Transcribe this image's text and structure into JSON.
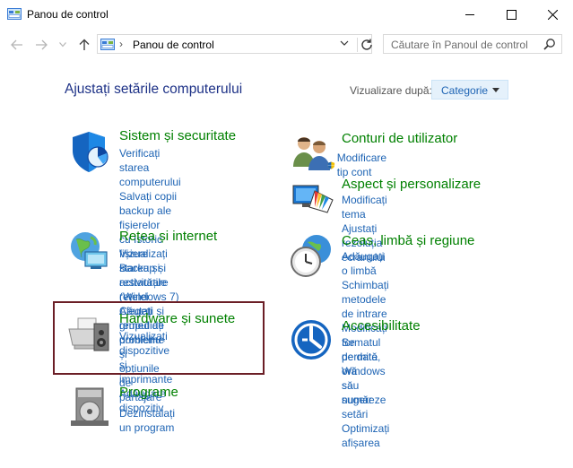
{
  "window": {
    "title": "Panou de control"
  },
  "address": {
    "location": "Panou de control"
  },
  "search": {
    "placeholder": "Căutare în Panoul de control"
  },
  "header": {
    "title": "Ajustați setările computerului",
    "view_by_label": "Vizualizare după:",
    "view_by_value": "Categorie"
  },
  "categories": [
    {
      "title": "Sistem și securitate",
      "links": [
        "Verificați starea computerului",
        "Salvați copii backup ale fișierelor",
        "cu Istoric fișiere",
        "Backup și restaurare (Windows 7)",
        "Căutați și remediați probleme"
      ]
    },
    {
      "title": "Rețea și internet",
      "links": [
        "Vizualizați starea și activitățile",
        "rețelei",
        "Alegeți grupul de domiciliu și",
        "opțiunile de partajare"
      ]
    },
    {
      "title": "Hardware și sunete",
      "links": [
        "Vizualizați dispozitive și",
        "imprimante",
        "Adăugare dispozitiv"
      ]
    },
    {
      "title": "Programe",
      "links": [
        "Dezinstalați un program"
      ]
    },
    {
      "title": "Conturi de utilizator",
      "links": [
        "Modificare tip cont"
      ]
    },
    {
      "title": "Aspect și personalizare",
      "links": [
        "Modificați tema",
        "Ajustați rezoluția ecranului"
      ]
    },
    {
      "title": "Ceas, limbă și regiune",
      "links": [
        "Adăugați o limbă",
        "Schimbați metodele de intrare",
        "Modificați formatul de dată, oră",
        "sau număr"
      ]
    },
    {
      "title": "Accesibilitate",
      "links": [
        "Se permite Windows să sugereze",
        "setări",
        "Optimizați afișarea"
      ]
    }
  ],
  "colors": {
    "category_title": "#008000",
    "link": "#1e64b4",
    "heading": "#1e3287",
    "highlight_border": "#6b1e26"
  }
}
